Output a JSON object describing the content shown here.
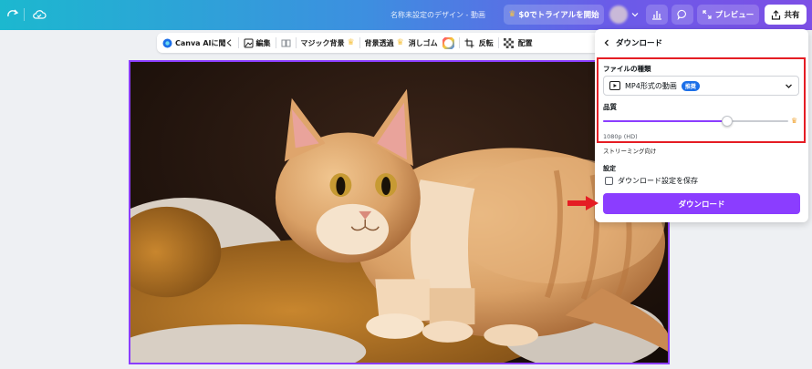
{
  "topbar": {
    "doc_title": "名称未設定のデザイン - 動画",
    "trial_label": "$0でトライアルを開始",
    "preview_label": "プレビュー",
    "share_label": "共有",
    "icons": [
      "redo-icon",
      "cloud-saved-icon",
      "crown-icon",
      "chevron-down-icon",
      "insights-icon",
      "comment-icon",
      "fullscreen-icon",
      "share-upload-icon"
    ]
  },
  "toolbar": {
    "items": [
      {
        "label": "Canva AIに聞く",
        "icon": "canva-ai-icon"
      },
      {
        "label": "編集",
        "icon": "edit-image-icon"
      },
      {
        "label": "",
        "icon": "flip-icon"
      },
      {
        "label": "マジック背景",
        "icon": "crown-icon"
      },
      {
        "label": "背景透過",
        "icon": "crown-icon"
      },
      {
        "label": "消しゴム",
        "icon": "eraser-icon"
      },
      {
        "label": "",
        "icon": "color-wheel-icon"
      },
      {
        "label": "",
        "icon": "crop-icon"
      },
      {
        "label": "反転",
        "icon": "flip-icon"
      },
      {
        "label": "",
        "icon": "transparency-icon"
      },
      {
        "label": "配置",
        "icon": "position-icon"
      }
    ]
  },
  "panel": {
    "title": "ダウンロード",
    "file_type_label": "ファイルの種類",
    "file_type_value": "MP4形式の動画",
    "file_type_badge": "推奨",
    "quality_label": "品質",
    "quality_fraction": 0.67,
    "quality_value": "1080p (HD)",
    "quality_hint": "ストリーミング向け",
    "settings_label": "設定",
    "save_settings_label": "ダウンロード設定を保存",
    "save_settings_checked": false,
    "download_button": "ダウンロード"
  },
  "colors": {
    "accent": "#8b3dff",
    "highlight_box": "#e51d24",
    "badge": "#1c6fe8"
  }
}
